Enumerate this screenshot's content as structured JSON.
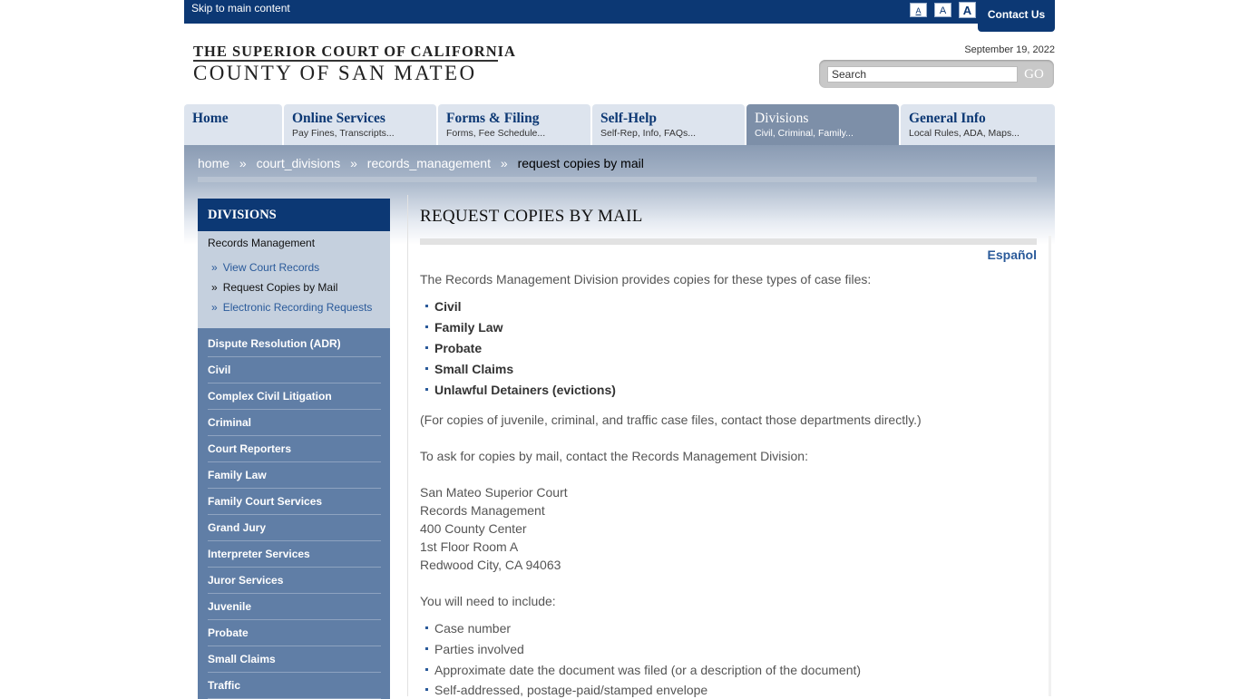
{
  "topbar": {
    "skip_link": "Skip to main content",
    "font_small": "A",
    "font_medium": "A",
    "font_large": "A",
    "contact": "Contact Us"
  },
  "header": {
    "logo_line1": "THE SUPERIOR COURT OF CALIFORNIA",
    "logo_line2": "COUNTY OF SAN MATEO",
    "date": "September 19, 2022",
    "search_value": "Search",
    "search_button": "GO"
  },
  "nav": [
    {
      "title": "Home",
      "sub": ""
    },
    {
      "title": "Online Services",
      "sub": "Pay Fines, Transcripts..."
    },
    {
      "title": "Forms & Filing",
      "sub": "Forms, Fee Schedule..."
    },
    {
      "title": "Self-Help",
      "sub": "Self-Rep, Info, FAQs..."
    },
    {
      "title": "Divisions",
      "sub": "Civil, Criminal, Family..."
    },
    {
      "title": "General Info",
      "sub": "Local Rules, ADA, Maps..."
    }
  ],
  "breadcrumb": {
    "items": [
      "home",
      "court_divisions",
      "records_management"
    ],
    "separator": "»",
    "current": "request copies by mail"
  },
  "sidebar": {
    "heading": "DIVISIONS",
    "section_title": "Records Management",
    "subitems": [
      "View Court Records",
      "Request Copies by Mail",
      "Electronic Recording Requests"
    ],
    "bullet": "»",
    "items": [
      "Dispute Resolution (ADR)",
      "Civil",
      "Complex Civil Litigation",
      "Criminal",
      "Court Reporters",
      "Family Law",
      "Family Court Services",
      "Grand Jury",
      "Interpreter Services",
      "Juror Services",
      "Juvenile",
      "Probate",
      "Small Claims",
      "Traffic"
    ]
  },
  "main": {
    "title": "REQUEST COPIES BY MAIL",
    "espanol": "Español",
    "intro": "The Records Management Division provides copies for these types of case files:",
    "case_types": [
      "Civil",
      "Family Law",
      "Probate",
      "Small Claims",
      "Unlawful Detainers (evictions)"
    ],
    "note": "(For copies of juvenile, criminal, and traffic case files, contact those departments directly.)",
    "contact_intro": "To ask for copies by mail, contact the Records Management Division:",
    "address": [
      "San Mateo Superior Court",
      "Records Management",
      "400 County Center",
      "1st Floor Room A",
      "Redwood City, CA 94063"
    ],
    "include_intro": "You will need to include:",
    "include_items": [
      "Case number",
      "Parties involved",
      "Approximate date the document was filed (or a description of the document)",
      "Self-addressed, postage-paid/stamped envelope"
    ]
  },
  "colors": {
    "navy": "#0c3874",
    "sidebar_blue": "#607ea6",
    "link_blue": "#2a5a9a"
  }
}
